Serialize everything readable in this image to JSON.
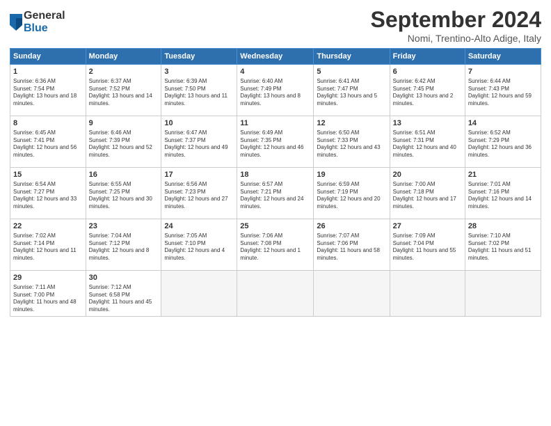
{
  "header": {
    "logo_line1": "General",
    "logo_line2": "Blue",
    "title": "September 2024",
    "subtitle": "Nomi, Trentino-Alto Adige, Italy"
  },
  "days_of_week": [
    "Sunday",
    "Monday",
    "Tuesday",
    "Wednesday",
    "Thursday",
    "Friday",
    "Saturday"
  ],
  "weeks": [
    [
      {
        "day": "1",
        "rise": "6:36 AM",
        "set": "7:54 PM",
        "daylight": "13 hours and 18 minutes."
      },
      {
        "day": "2",
        "rise": "6:37 AM",
        "set": "7:52 PM",
        "daylight": "13 hours and 14 minutes."
      },
      {
        "day": "3",
        "rise": "6:39 AM",
        "set": "7:50 PM",
        "daylight": "13 hours and 11 minutes."
      },
      {
        "day": "4",
        "rise": "6:40 AM",
        "set": "7:49 PM",
        "daylight": "13 hours and 8 minutes."
      },
      {
        "day": "5",
        "rise": "6:41 AM",
        "set": "7:47 PM",
        "daylight": "13 hours and 5 minutes."
      },
      {
        "day": "6",
        "rise": "6:42 AM",
        "set": "7:45 PM",
        "daylight": "13 hours and 2 minutes."
      },
      {
        "day": "7",
        "rise": "6:44 AM",
        "set": "7:43 PM",
        "daylight": "12 hours and 59 minutes."
      }
    ],
    [
      {
        "day": "8",
        "rise": "6:45 AM",
        "set": "7:41 PM",
        "daylight": "12 hours and 56 minutes."
      },
      {
        "day": "9",
        "rise": "6:46 AM",
        "set": "7:39 PM",
        "daylight": "12 hours and 52 minutes."
      },
      {
        "day": "10",
        "rise": "6:47 AM",
        "set": "7:37 PM",
        "daylight": "12 hours and 49 minutes."
      },
      {
        "day": "11",
        "rise": "6:49 AM",
        "set": "7:35 PM",
        "daylight": "12 hours and 46 minutes."
      },
      {
        "day": "12",
        "rise": "6:50 AM",
        "set": "7:33 PM",
        "daylight": "12 hours and 43 minutes."
      },
      {
        "day": "13",
        "rise": "6:51 AM",
        "set": "7:31 PM",
        "daylight": "12 hours and 40 minutes."
      },
      {
        "day": "14",
        "rise": "6:52 AM",
        "set": "7:29 PM",
        "daylight": "12 hours and 36 minutes."
      }
    ],
    [
      {
        "day": "15",
        "rise": "6:54 AM",
        "set": "7:27 PM",
        "daylight": "12 hours and 33 minutes."
      },
      {
        "day": "16",
        "rise": "6:55 AM",
        "set": "7:25 PM",
        "daylight": "12 hours and 30 minutes."
      },
      {
        "day": "17",
        "rise": "6:56 AM",
        "set": "7:23 PM",
        "daylight": "12 hours and 27 minutes."
      },
      {
        "day": "18",
        "rise": "6:57 AM",
        "set": "7:21 PM",
        "daylight": "12 hours and 24 minutes."
      },
      {
        "day": "19",
        "rise": "6:59 AM",
        "set": "7:19 PM",
        "daylight": "12 hours and 20 minutes."
      },
      {
        "day": "20",
        "rise": "7:00 AM",
        "set": "7:18 PM",
        "daylight": "12 hours and 17 minutes."
      },
      {
        "day": "21",
        "rise": "7:01 AM",
        "set": "7:16 PM",
        "daylight": "12 hours and 14 minutes."
      }
    ],
    [
      {
        "day": "22",
        "rise": "7:02 AM",
        "set": "7:14 PM",
        "daylight": "12 hours and 11 minutes."
      },
      {
        "day": "23",
        "rise": "7:04 AM",
        "set": "7:12 PM",
        "daylight": "12 hours and 8 minutes."
      },
      {
        "day": "24",
        "rise": "7:05 AM",
        "set": "7:10 PM",
        "daylight": "12 hours and 4 minutes."
      },
      {
        "day": "25",
        "rise": "7:06 AM",
        "set": "7:08 PM",
        "daylight": "12 hours and 1 minute."
      },
      {
        "day": "26",
        "rise": "7:07 AM",
        "set": "7:06 PM",
        "daylight": "11 hours and 58 minutes."
      },
      {
        "day": "27",
        "rise": "7:09 AM",
        "set": "7:04 PM",
        "daylight": "11 hours and 55 minutes."
      },
      {
        "day": "28",
        "rise": "7:10 AM",
        "set": "7:02 PM",
        "daylight": "11 hours and 51 minutes."
      }
    ],
    [
      {
        "day": "29",
        "rise": "7:11 AM",
        "set": "7:00 PM",
        "daylight": "11 hours and 48 minutes."
      },
      {
        "day": "30",
        "rise": "7:12 AM",
        "set": "6:58 PM",
        "daylight": "11 hours and 45 minutes."
      },
      null,
      null,
      null,
      null,
      null
    ]
  ]
}
